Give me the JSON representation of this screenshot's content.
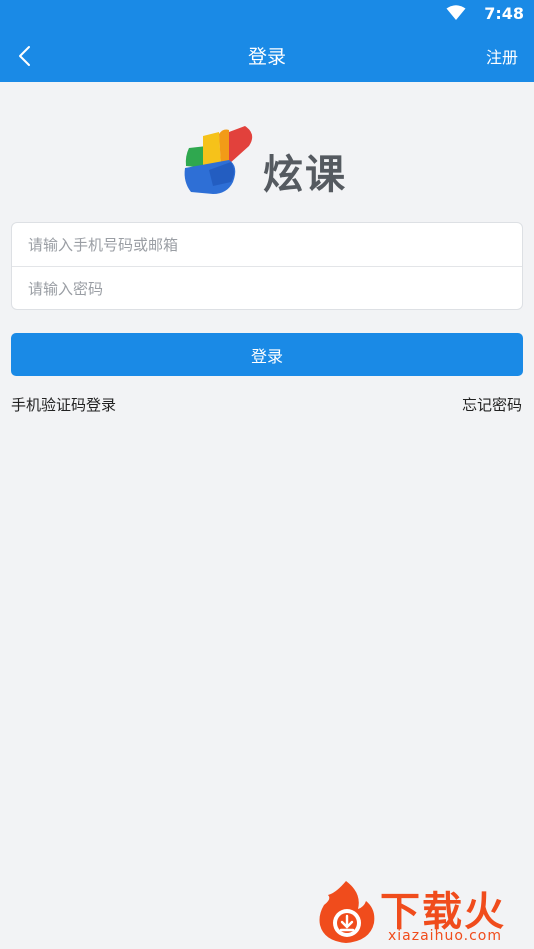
{
  "status_bar": {
    "time": "7:48",
    "wifi_icon": "wifi-icon"
  },
  "header": {
    "back_icon": "chevron-left-icon",
    "title": "登录",
    "register_label": "注册"
  },
  "logo": {
    "text": "炫课"
  },
  "form": {
    "account_placeholder": "请输入手机号码或邮箱",
    "account_value": "",
    "password_placeholder": "请输入密码",
    "password_value": "",
    "login_label": "登录"
  },
  "links": {
    "sms_login": "手机验证码登录",
    "forgot_password": "忘记密码"
  },
  "watermark": {
    "title": "下载火",
    "url": "xiazaihuo.com"
  },
  "colors": {
    "primary": "#1a8ae6",
    "background": "#f2f3f5",
    "watermark": "#f04c1c"
  }
}
